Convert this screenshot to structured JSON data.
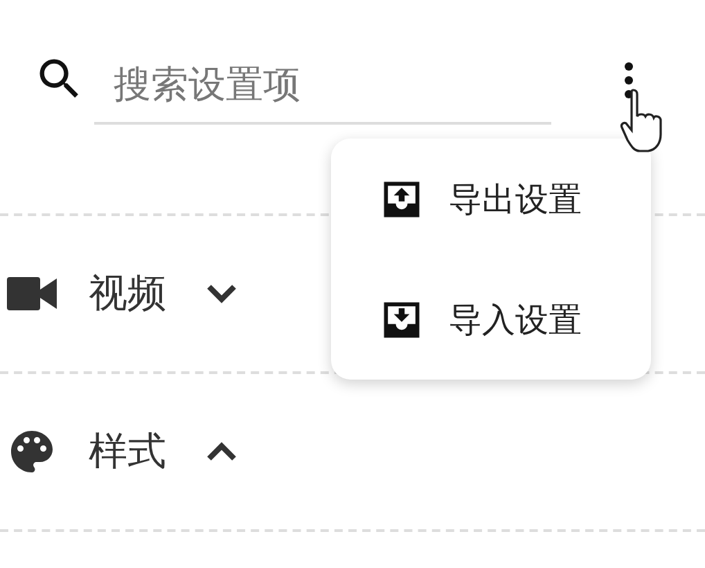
{
  "search": {
    "placeholder": "搜索设置项"
  },
  "menu": {
    "items": [
      {
        "kind": "export",
        "label": "导出设置"
      },
      {
        "kind": "import",
        "label": "导入设置"
      }
    ]
  },
  "sections": [
    {
      "kind": "video",
      "label": "视频",
      "expanded": false
    },
    {
      "kind": "style",
      "label": "样式",
      "expanded": true
    }
  ]
}
